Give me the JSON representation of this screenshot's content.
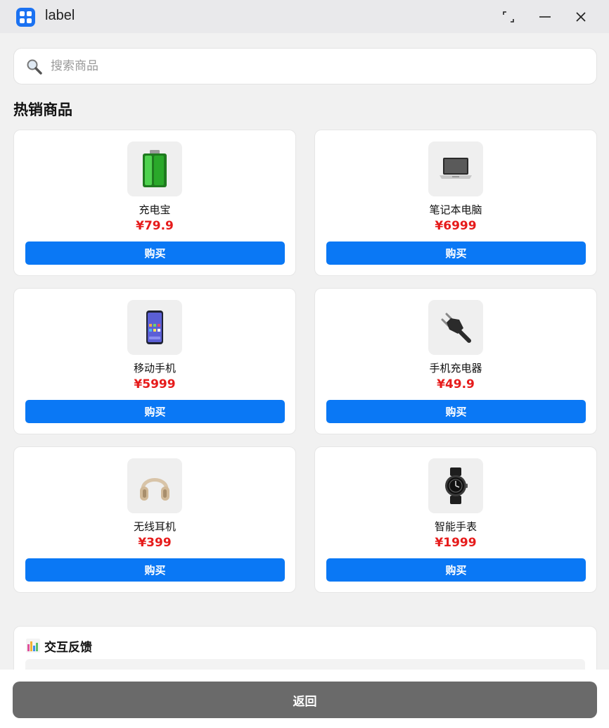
{
  "window": {
    "title": "label"
  },
  "search": {
    "placeholder": "搜索商品",
    "value": ""
  },
  "section": {
    "title": "热销商品"
  },
  "products": [
    {
      "name": "充电宝",
      "price": "¥79.9",
      "buy_label": "购买",
      "icon": "power-bank-icon"
    },
    {
      "name": "笔记本电脑",
      "price": "¥6999",
      "buy_label": "购买",
      "icon": "laptop-icon"
    },
    {
      "name": "移动手机",
      "price": "¥5999",
      "buy_label": "购买",
      "icon": "phone-icon"
    },
    {
      "name": "手机充电器",
      "price": "¥49.9",
      "buy_label": "购买",
      "icon": "charger-plug-icon"
    },
    {
      "name": "无线耳机",
      "price": "¥399",
      "buy_label": "购买",
      "icon": "headphones-icon"
    },
    {
      "name": "智能手表",
      "price": "¥1999",
      "buy_label": "购买",
      "icon": "smartwatch-icon"
    }
  ],
  "feedback": {
    "title": "交互反馈",
    "icon": "bar-chart-icon"
  },
  "footer": {
    "back_label": "返回"
  },
  "colors": {
    "accent": "#0a78f5",
    "price": "#e61b1b",
    "back_button": "#6a6a6a"
  }
}
